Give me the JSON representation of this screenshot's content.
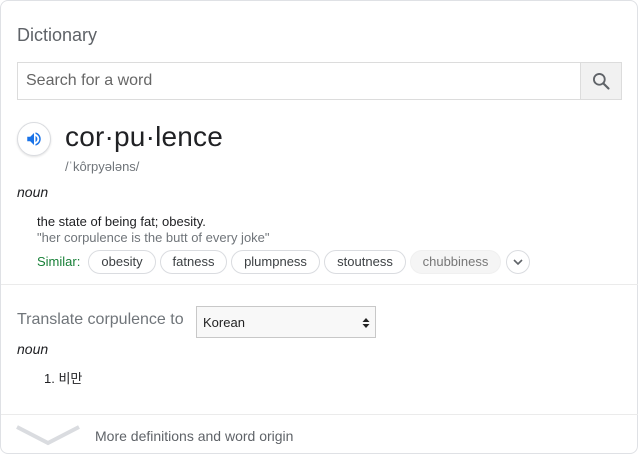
{
  "panel": {
    "title": "Dictionary"
  },
  "search": {
    "placeholder": "Search for a word",
    "button_icon": "search-icon"
  },
  "entry": {
    "speaker_icon": "speaker-icon",
    "headword": "cor·pu·lence",
    "phonetic": "/ˈkôrpyələns/",
    "part_of_speech": "noun",
    "definition": "the state of being fat; obesity.",
    "example": "\"her corpulence is the butt of every joke\"",
    "similar_label": "Similar:",
    "similar": [
      "obesity",
      "fatness",
      "plumpness",
      "stoutness",
      "chubbiness"
    ],
    "expand_icon": "chevron-down-icon"
  },
  "translate": {
    "label": "Translate corpulence to",
    "selected_language": "Korean",
    "part_of_speech": "noun",
    "items": [
      "1. 비만"
    ]
  },
  "footer": {
    "more_label": "More definitions and word origin",
    "icon": "chevron-down-icon"
  },
  "colors": {
    "similar_label": "#188038",
    "speaker_icon": "#1a73e8",
    "divider": "#ebebeb"
  }
}
